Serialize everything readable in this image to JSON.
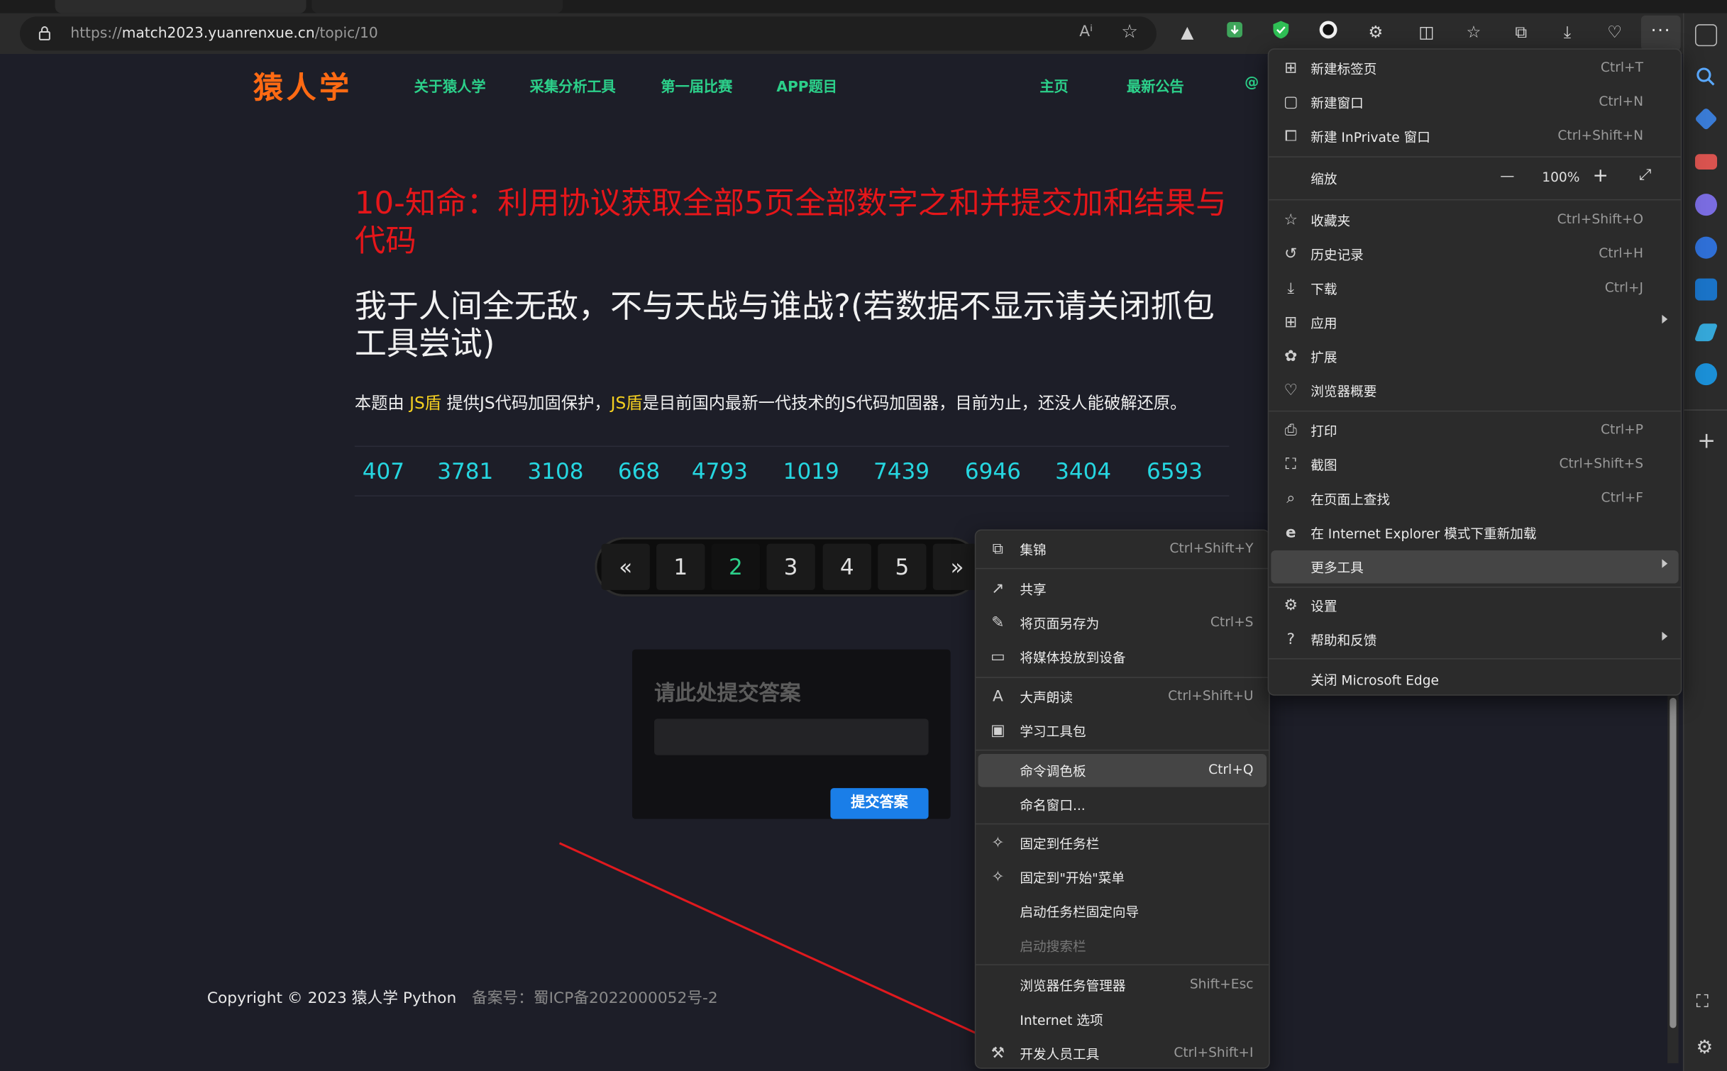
{
  "browser": {
    "url_prefix": "https://",
    "url_host": "match2023.yuanrenxue.cn",
    "url_path": "/topic/10",
    "more_button": "···"
  },
  "site": {
    "logo": "猿人学",
    "nav": [
      "关于猿人学",
      "采集分析工具",
      "第一届比赛",
      "APP题目",
      "主页",
      "最新公告",
      "@"
    ],
    "title_red": "10-知命：利用协议获取全部5页全部数字之和并提交加和结果与代码",
    "title_white": "我于人间全无敌，不与天战与谁战?(若数据不显示请关闭抓包工具尝试)",
    "desc_parts": [
      "本题由 ",
      "JS盾",
      " 提供JS代码加固保护，",
      "JS盾",
      "是目前国内最新一代技术的JS代码加固器，目前为止，还没人能破解还原。"
    ],
    "numbers": [
      "407",
      "3781",
      "3108",
      "668",
      "4793",
      "1019",
      "7439",
      "6946",
      "3404",
      "6593"
    ],
    "pager": [
      "«",
      "1",
      "2",
      "3",
      "4",
      "5",
      "»"
    ],
    "pager_active": "2",
    "answer_label": "请此处提交答案",
    "answer_input_value": "",
    "submit_label": "提交答案",
    "footer_copyright": "Copyright © 2023 猿人学 Python",
    "footer_icp": "备案号：蜀ICP备2022000052号-2"
  },
  "main_menu": {
    "items": [
      {
        "label": "新建标签页",
        "shortcut": "Ctrl+T",
        "icon": "new-tab-icon"
      },
      {
        "label": "新建窗口",
        "shortcut": "Ctrl+N",
        "icon": "new-window-icon"
      },
      {
        "label": "新建 InPrivate 窗口",
        "shortcut": "Ctrl+Shift+N",
        "icon": "inprivate-icon"
      },
      {
        "label": "缩放",
        "zoom": "100%",
        "minus": "—",
        "plus": "+",
        "icon": "zoom"
      },
      {
        "label": "收藏夹",
        "shortcut": "Ctrl+Shift+O",
        "icon": "favorites-icon"
      },
      {
        "label": "历史记录",
        "shortcut": "Ctrl+H",
        "icon": "history-icon"
      },
      {
        "label": "下载",
        "shortcut": "Ctrl+J",
        "icon": "download-icon"
      },
      {
        "label": "应用",
        "shortcut": "",
        "icon": "apps-icon"
      },
      {
        "label": "扩展",
        "shortcut": "",
        "icon": "extensions-icon"
      },
      {
        "label": "浏览器概要",
        "shortcut": "",
        "icon": "browser-essentials-icon"
      },
      {
        "label": "打印",
        "shortcut": "Ctrl+P",
        "icon": "print-icon"
      },
      {
        "label": "截图",
        "shortcut": "Ctrl+Shift+S",
        "icon": "screenshot-icon"
      },
      {
        "label": "在页面上查找",
        "shortcut": "Ctrl+F",
        "icon": "find-icon"
      },
      {
        "label": "在 Internet Explorer 模式下重新加载",
        "shortcut": "",
        "icon": "ie-icon"
      },
      {
        "label": "更多工具",
        "shortcut": "",
        "icon": ""
      },
      {
        "label": "设置",
        "shortcut": "",
        "icon": "settings-icon"
      },
      {
        "label": "帮助和反馈",
        "shortcut": "",
        "icon": "help-icon"
      },
      {
        "label": "关闭 Microsoft Edge",
        "shortcut": "",
        "icon": ""
      }
    ]
  },
  "sub_menu": {
    "items": [
      {
        "label": "集锦",
        "shortcut": "Ctrl+Shift+Y",
        "icon": "collections-icon"
      },
      {
        "label": "共享",
        "shortcut": "",
        "icon": "share-icon"
      },
      {
        "label": "将页面另存为",
        "shortcut": "Ctrl+S",
        "icon": "save-page-icon"
      },
      {
        "label": "将媒体投放到设备",
        "shortcut": "",
        "icon": "cast-icon"
      },
      {
        "label": "大声朗读",
        "shortcut": "Ctrl+Shift+U",
        "icon": "read-aloud-icon"
      },
      {
        "label": "学习工具包",
        "shortcut": "",
        "icon": "learning-toolkit-icon"
      },
      {
        "label": "命令调色板",
        "shortcut": "Ctrl+Q",
        "icon": ""
      },
      {
        "label": "命名窗口...",
        "shortcut": "",
        "icon": ""
      },
      {
        "label": "固定到任务栏",
        "shortcut": "",
        "icon": "pin-icon"
      },
      {
        "label": "固定到\"开始\"菜单",
        "shortcut": "",
        "icon": "pin-icon"
      },
      {
        "label": "启动任务栏固定向导",
        "shortcut": "",
        "icon": ""
      },
      {
        "label": "启动搜索栏",
        "shortcut": "",
        "icon": ""
      },
      {
        "label": "浏览器任务管理器",
        "shortcut": "Shift+Esc",
        "icon": ""
      },
      {
        "label": "Internet 选项",
        "shortcut": "",
        "icon": ""
      },
      {
        "label": "开发人员工具",
        "shortcut": "Ctrl+Shift+I",
        "icon": "devtools-icon"
      }
    ]
  },
  "colors": {
    "page_bg": "#1d1e28",
    "logo": "#ff6a13",
    "nav": "#2cd08a",
    "title_red": "#e5161a",
    "numbers": "#26d6e0",
    "highlight": "#f5d020",
    "submit": "#1a7ee8",
    "arrow": "#e0191e"
  }
}
